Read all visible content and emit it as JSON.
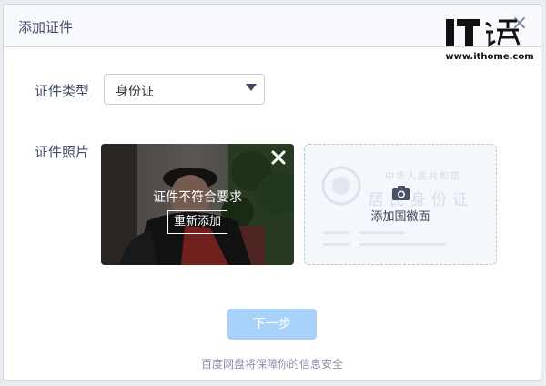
{
  "dialog": {
    "title": "添加证件",
    "close_glyph": "×"
  },
  "watermark": {
    "logo_text": "IT之家",
    "url": "www.ithome.com"
  },
  "form": {
    "type_label": "证件类型",
    "type_value": "身份证",
    "photo_label": "证件照片"
  },
  "front_photo": {
    "status_text": "证件不符合要求",
    "readd_label": "重新添加"
  },
  "back_photo": {
    "caption": "添加国徽面",
    "bg_title": "中华人民共和国",
    "bg_subtitle": "居民身份证"
  },
  "actions": {
    "next_label": "下一步"
  },
  "footer": {
    "note": "百度网盘将保障你的信息安全"
  },
  "colors": {
    "accent_disabled": "#a9d2fb",
    "text_primary": "#424e67",
    "text_muted": "#8a94a6"
  }
}
